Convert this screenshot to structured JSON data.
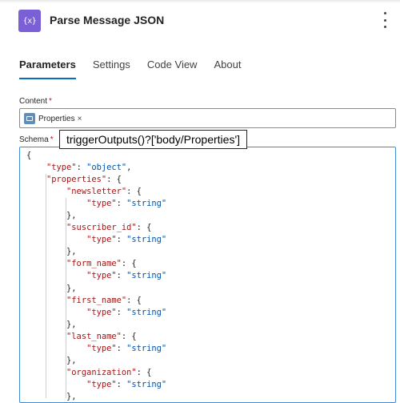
{
  "header": {
    "icon_glyph": "{x}",
    "title": "Parse Message JSON",
    "more_icon": "more-vertical-icon"
  },
  "tabs": [
    {
      "label": "Parameters",
      "active": true
    },
    {
      "label": "Settings",
      "active": false
    },
    {
      "label": "Code View",
      "active": false
    },
    {
      "label": "About",
      "active": false
    }
  ],
  "content_field": {
    "label": "Content",
    "required_mark": "*",
    "token": {
      "label": "Properties",
      "remove": "×"
    }
  },
  "schema_field": {
    "label": "Schema",
    "required_mark": "*",
    "tooltip": "triggerOutputs()?['body/Properties']"
  },
  "colors": {
    "accent": "#0f6cbd",
    "icon_bg": "#7a5fd6",
    "json_key": "#a31515",
    "json_string": "#0451a5",
    "required": "#c50f1f"
  },
  "schema_code": [
    {
      "indent": 0,
      "parts": [
        {
          "t": "{",
          "c": "p"
        }
      ]
    },
    {
      "indent": 1,
      "parts": [
        {
          "t": "\"type\"",
          "c": "k"
        },
        {
          "t": ": ",
          "c": "p"
        },
        {
          "t": "\"object\"",
          "c": "s"
        },
        {
          "t": ",",
          "c": "p"
        }
      ]
    },
    {
      "indent": 1,
      "parts": [
        {
          "t": "\"properties\"",
          "c": "k"
        },
        {
          "t": ": {",
          "c": "p"
        }
      ]
    },
    {
      "indent": 2,
      "parts": [
        {
          "t": "\"newsletter\"",
          "c": "k"
        },
        {
          "t": ": {",
          "c": "p"
        }
      ]
    },
    {
      "indent": 3,
      "parts": [
        {
          "t": "\"type\"",
          "c": "k"
        },
        {
          "t": ": ",
          "c": "p"
        },
        {
          "t": "\"string\"",
          "c": "s"
        }
      ]
    },
    {
      "indent": 2,
      "parts": [
        {
          "t": "},",
          "c": "p"
        }
      ]
    },
    {
      "indent": 2,
      "parts": [
        {
          "t": "\"suscriber_id\"",
          "c": "k"
        },
        {
          "t": ": {",
          "c": "p"
        }
      ]
    },
    {
      "indent": 3,
      "parts": [
        {
          "t": "\"type\"",
          "c": "k"
        },
        {
          "t": ": ",
          "c": "p"
        },
        {
          "t": "\"string\"",
          "c": "s"
        }
      ]
    },
    {
      "indent": 2,
      "parts": [
        {
          "t": "},",
          "c": "p"
        }
      ]
    },
    {
      "indent": 2,
      "parts": [
        {
          "t": "\"form_name\"",
          "c": "k"
        },
        {
          "t": ": {",
          "c": "p"
        }
      ]
    },
    {
      "indent": 3,
      "parts": [
        {
          "t": "\"type\"",
          "c": "k"
        },
        {
          "t": ": ",
          "c": "p"
        },
        {
          "t": "\"string\"",
          "c": "s"
        }
      ]
    },
    {
      "indent": 2,
      "parts": [
        {
          "t": "},",
          "c": "p"
        }
      ]
    },
    {
      "indent": 2,
      "parts": [
        {
          "t": "\"first_name\"",
          "c": "k"
        },
        {
          "t": ": {",
          "c": "p"
        }
      ]
    },
    {
      "indent": 3,
      "parts": [
        {
          "t": "\"type\"",
          "c": "k"
        },
        {
          "t": ": ",
          "c": "p"
        },
        {
          "t": "\"string\"",
          "c": "s"
        }
      ]
    },
    {
      "indent": 2,
      "parts": [
        {
          "t": "},",
          "c": "p"
        }
      ]
    },
    {
      "indent": 2,
      "parts": [
        {
          "t": "\"last_name\"",
          "c": "k"
        },
        {
          "t": ": {",
          "c": "p"
        }
      ]
    },
    {
      "indent": 3,
      "parts": [
        {
          "t": "\"type\"",
          "c": "k"
        },
        {
          "t": ": ",
          "c": "p"
        },
        {
          "t": "\"string\"",
          "c": "s"
        }
      ]
    },
    {
      "indent": 2,
      "parts": [
        {
          "t": "},",
          "c": "p"
        }
      ]
    },
    {
      "indent": 2,
      "parts": [
        {
          "t": "\"organization\"",
          "c": "k"
        },
        {
          "t": ": {",
          "c": "p"
        }
      ]
    },
    {
      "indent": 3,
      "parts": [
        {
          "t": "\"type\"",
          "c": "k"
        },
        {
          "t": ": ",
          "c": "p"
        },
        {
          "t": "\"string\"",
          "c": "s"
        }
      ]
    },
    {
      "indent": 2,
      "parts": [
        {
          "t": "},",
          "c": "p"
        }
      ]
    }
  ]
}
